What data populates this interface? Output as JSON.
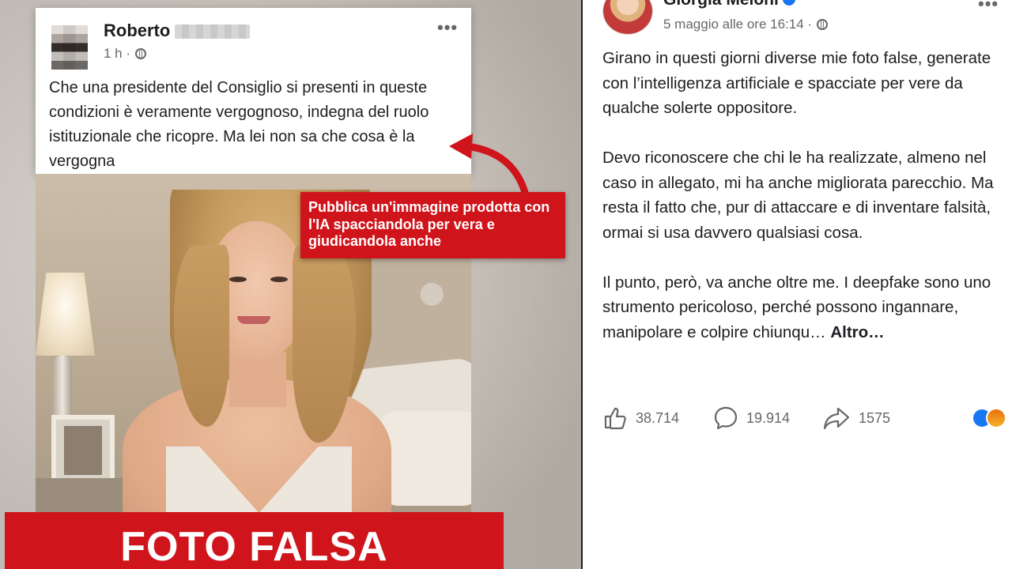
{
  "left": {
    "fake_post": {
      "author_first_name": "Roberto",
      "time": "1 h ·",
      "text": "Che una presidente del Consiglio  si presenti in queste condizioni è veramente vergognoso, indegna del ruolo istituzionale che ricopre. Ma lei non sa che cosa è la vergogna"
    },
    "callout_text": "Pubblica un'immagine prodotta con l'IA spacciandola per vera e giudicandola anche",
    "banner_text": "FOTO FALSA"
  },
  "right": {
    "author": "Giorgia Meloni",
    "date": "5 maggio alle ore 16:14 ·",
    "paragraphs": [
      "Girano in questi giorni diverse mie foto false, generate con l’intelligenza artificiale e spacciate per vere da qualche solerte oppositore.",
      "Devo riconoscere che chi le ha realizzate, almeno nel caso in allegato, mi ha anche migliorata parecchio. Ma resta il fatto che, pur di attaccare e di inventare falsità, ormai si usa davvero qualsiasi cosa.",
      "Il punto, però, va anche oltre me. I deepfake sono uno strumento pericoloso, perché possono ingannare, manipolare e colpire chiunqu…"
    ],
    "more_label": "Altro…",
    "stats": {
      "likes": "38.714",
      "comments": "19.914",
      "shares": "1575"
    }
  },
  "icons": {
    "more_options": "more-options-icon",
    "globe": "globe-icon",
    "like": "like-icon",
    "comment": "comment-icon",
    "share": "share-icon",
    "verified": "verified-badge-icon"
  },
  "colors": {
    "alert_red": "#d0141b",
    "facebook_blue": "#1877f2",
    "muted_text": "#65676b"
  }
}
